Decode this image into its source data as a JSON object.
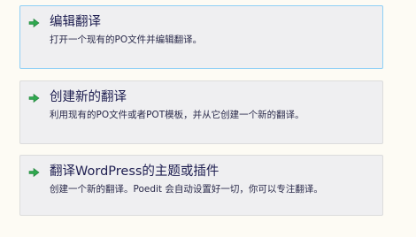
{
  "actions": [
    {
      "title": "编辑翻译",
      "description": "打开一个现有的PO文件并编辑翻译。",
      "icon": "green-arrow-right-icon"
    },
    {
      "title": "创建新的翻译",
      "description": "利用现有的PO文件或者POT模板，并从它创建一个新的翻译。",
      "icon": "green-arrow-right-icon"
    },
    {
      "title": "翻译WordPress的主题或插件",
      "description": "创建一个新的翻译。Poedit 会自动设置好一切，你可以专注翻译。",
      "icon": "green-arrow-right-icon"
    }
  ],
  "colors": {
    "background": "#fdfbf4",
    "card": "#efeff1",
    "selected_border": "#8fd0f6",
    "arrow": "#2fa84f",
    "title_text": "#1e1e50"
  }
}
